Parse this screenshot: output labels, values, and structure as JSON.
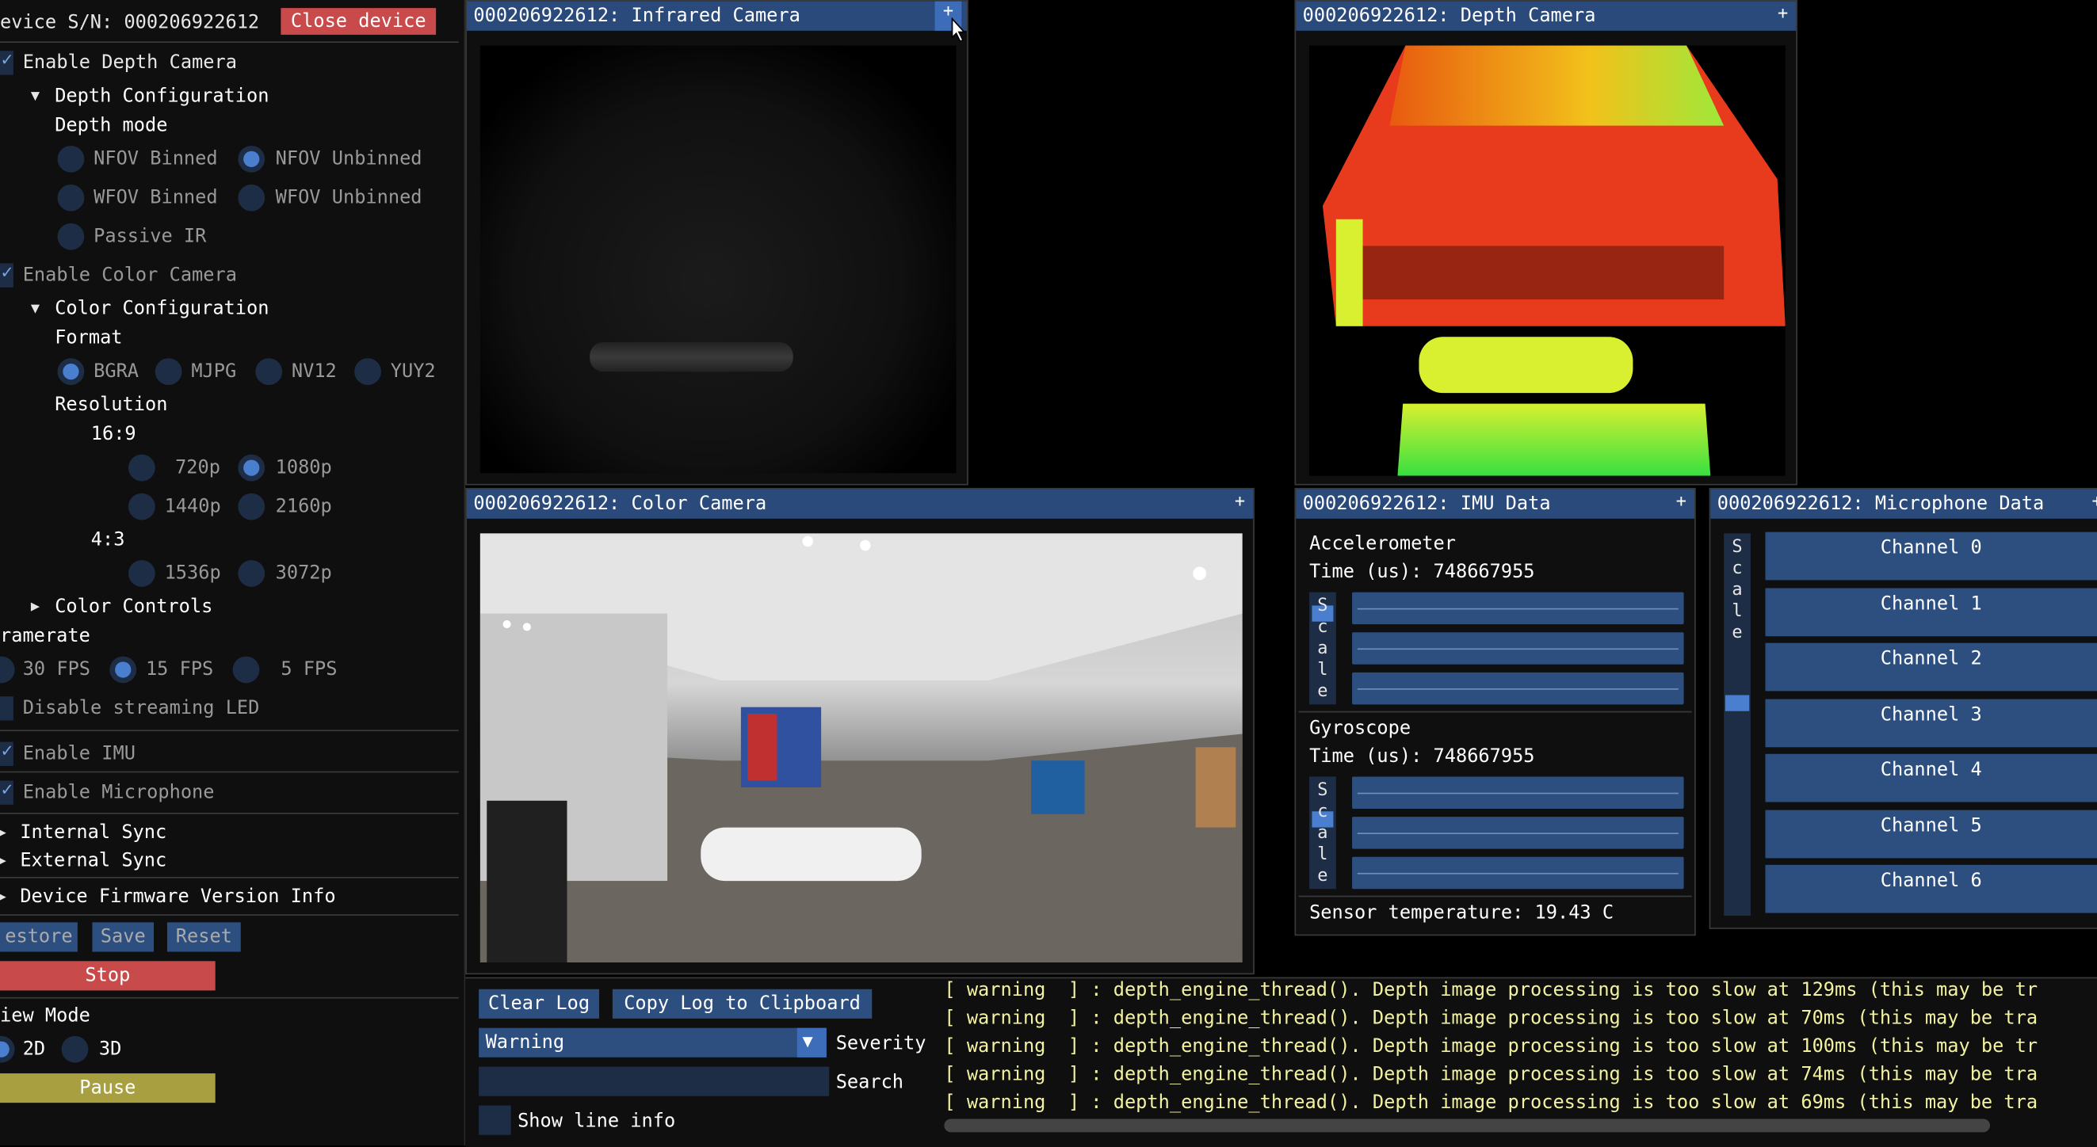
{
  "sidebar": {
    "device_sn": "evice S/N: 000206922612",
    "close_device": "Close device",
    "enable_depth": "Enable Depth Camera",
    "depth_config": "Depth Configuration",
    "depth_mode": "Depth mode",
    "depth_modes": [
      "NFOV Binned",
      "NFOV Unbinned",
      "WFOV Binned",
      "WFOV Unbinned",
      "Passive IR"
    ],
    "enable_color": "Enable Color Camera",
    "color_config": "Color Configuration",
    "format": "Format",
    "formats": [
      "BGRA",
      "MJPG",
      "NV12",
      "YUY2"
    ],
    "resolution": "Resolution",
    "ratio_169": "16:9",
    "res_169": [
      "720p",
      "1080p",
      "1440p",
      "2160p"
    ],
    "ratio_43": "4:3",
    "res_43": [
      "1536p",
      "3072p"
    ],
    "color_controls": "Color Controls",
    "framerate": "ramerate",
    "fps": [
      "30 FPS",
      "15 FPS",
      "5 FPS"
    ],
    "disable_led": "Disable streaming LED",
    "enable_imu": "Enable IMU",
    "enable_mic": "Enable Microphone",
    "internal_sync": "Internal Sync",
    "external_sync": "External Sync",
    "firmware": "Device Firmware Version Info",
    "restore": "estore",
    "save": "Save",
    "reset": "Reset",
    "stop": "Stop",
    "view_mode": "iew Mode",
    "view_2d": "2D",
    "view_3d": "3D",
    "pause": "Pause"
  },
  "windows": {
    "infrared": "000206922612: Infrared Camera",
    "depth": "000206922612: Depth Camera",
    "color": "000206922612: Color Camera",
    "imu": "000206922612: IMU Data",
    "mic": "000206922612: Microphone Data",
    "plus": "+"
  },
  "imu": {
    "accel": "Accelerometer",
    "accel_time": "Time (us): 748667955",
    "gyro": "Gyroscope",
    "gyro_time": "Time (us): 748667955",
    "scale_letters": [
      "S",
      "c",
      "a",
      "l",
      "e"
    ],
    "temp": "Sensor temperature: 19.43 C"
  },
  "mic": {
    "scale_letters": [
      "S",
      "c",
      "a",
      "l",
      "e"
    ],
    "channels": [
      "Channel 0",
      "Channel 1",
      "Channel 2",
      "Channel 3",
      "Channel 4",
      "Channel 5",
      "Channel 6"
    ]
  },
  "log": {
    "clear": "Clear Log",
    "copy": "Copy Log to Clipboard",
    "severity_value": "Warning",
    "severity_label": "Severity",
    "search_label": "Search",
    "search_value": "",
    "show_line_info": "Show line info",
    "lines": [
      "[ warning  ] : depth_engine_thread(). Depth image processing is too slow at 129ms (this may be tr",
      "[ warning  ] : depth_engine_thread(). Depth image processing is too slow at 70ms (this may be tra",
      "[ warning  ] : depth_engine_thread(). Depth image processing is too slow at 100ms (this may be tr",
      "[ warning  ] : depth_engine_thread(). Depth image processing is too slow at 74ms (this may be tra",
      "[ warning  ] : depth_engine_thread(). Depth image processing is too slow at 69ms (this may be tra"
    ]
  },
  "colors": {
    "title_bg": "#294a7a",
    "widget_bg": "#2d4f80",
    "close_btn": "#c84a4a",
    "stop_btn": "#c84a4a",
    "pause_btn": "#a8a040",
    "log_text": "#f2f2a0"
  }
}
